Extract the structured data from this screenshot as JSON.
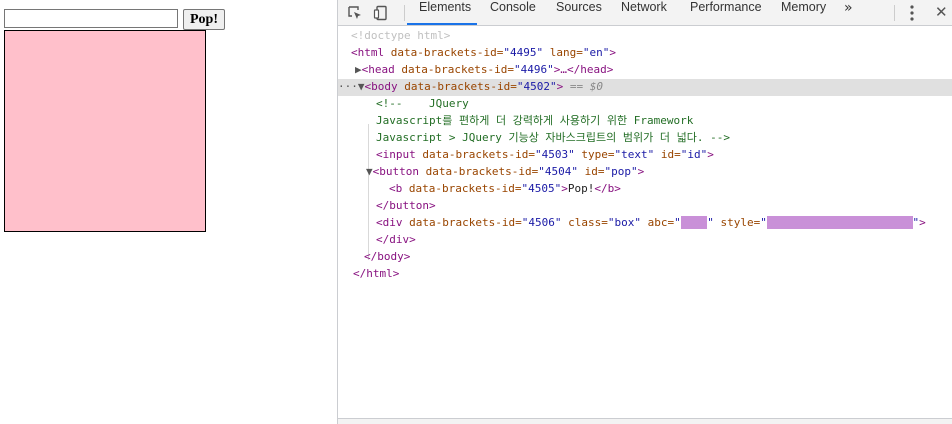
{
  "page": {
    "input_value": "",
    "button_label": "Pop!",
    "box_color": "#ffc0cb"
  },
  "devtools": {
    "toolbar_icons": [
      "inspect-element-icon",
      "device-toolbar-icon"
    ],
    "tabs": [
      {
        "label": "Elements",
        "active": true
      },
      {
        "label": "Console",
        "active": false
      },
      {
        "label": "Sources",
        "active": false
      },
      {
        "label": "Network",
        "active": false
      },
      {
        "label": "Performance",
        "active": false
      },
      {
        "label": "Memory",
        "active": false
      }
    ],
    "more_tabs": "»",
    "accent": "#1a73e8",
    "dom": {
      "doctype": "<!doctype html>",
      "html_open": {
        "tag": "<html ",
        "attr1": "data-brackets-id=",
        "val1": "\"4495\"",
        "attr2": " lang=",
        "val2": "\"en\"",
        "end": ">"
      },
      "head": {
        "tag": "<head ",
        "attr": "data-brackets-id=",
        "val": "\"4496\"",
        "end": ">…</head>"
      },
      "body_open": {
        "tag": "<body ",
        "attr": "data-brackets-id=",
        "val": "\"4502\"",
        "end": ">",
        "eq": " == $0"
      },
      "comment": [
        "<!--    JQuery",
        "Javascript를 편하게 더 강력하게 사용하기 위한 Framework",
        "Javascript > JQuery 기능상 자바스크립트의 범위가 더 넓다. -->"
      ],
      "input_line": {
        "tag": "<input ",
        "attr1": "data-brackets-id=",
        "val1": "\"4503\"",
        "attr2": " type=",
        "val2": "\"text\"",
        "attr3": " id=",
        "val3": "\"id\"",
        "end": ">"
      },
      "button_open": {
        "tag": "<button ",
        "attr1": "data-brackets-id=",
        "val1": "\"4504\"",
        "attr2": " id=",
        "val2": "\"pop\"",
        "end": ">"
      },
      "b_line": {
        "tag": "<b ",
        "attr": "data-brackets-id=",
        "val": "\"4505\"",
        "gt": ">",
        "text": "Pop!",
        "close": "</b>"
      },
      "button_close": "</button>",
      "div_open": {
        "tag": "<div ",
        "attr1": "data-brackets-id=",
        "val1": "\"4506\"",
        "attr2": " class=",
        "val2": "\"box\"",
        "attr3": " abc=",
        "val3": "\"",
        "attr4": " style=",
        "val4": "\"",
        "end": ">"
      },
      "div_close": "</div>",
      "body_close": "</body>",
      "html_close": "</html>"
    }
  }
}
